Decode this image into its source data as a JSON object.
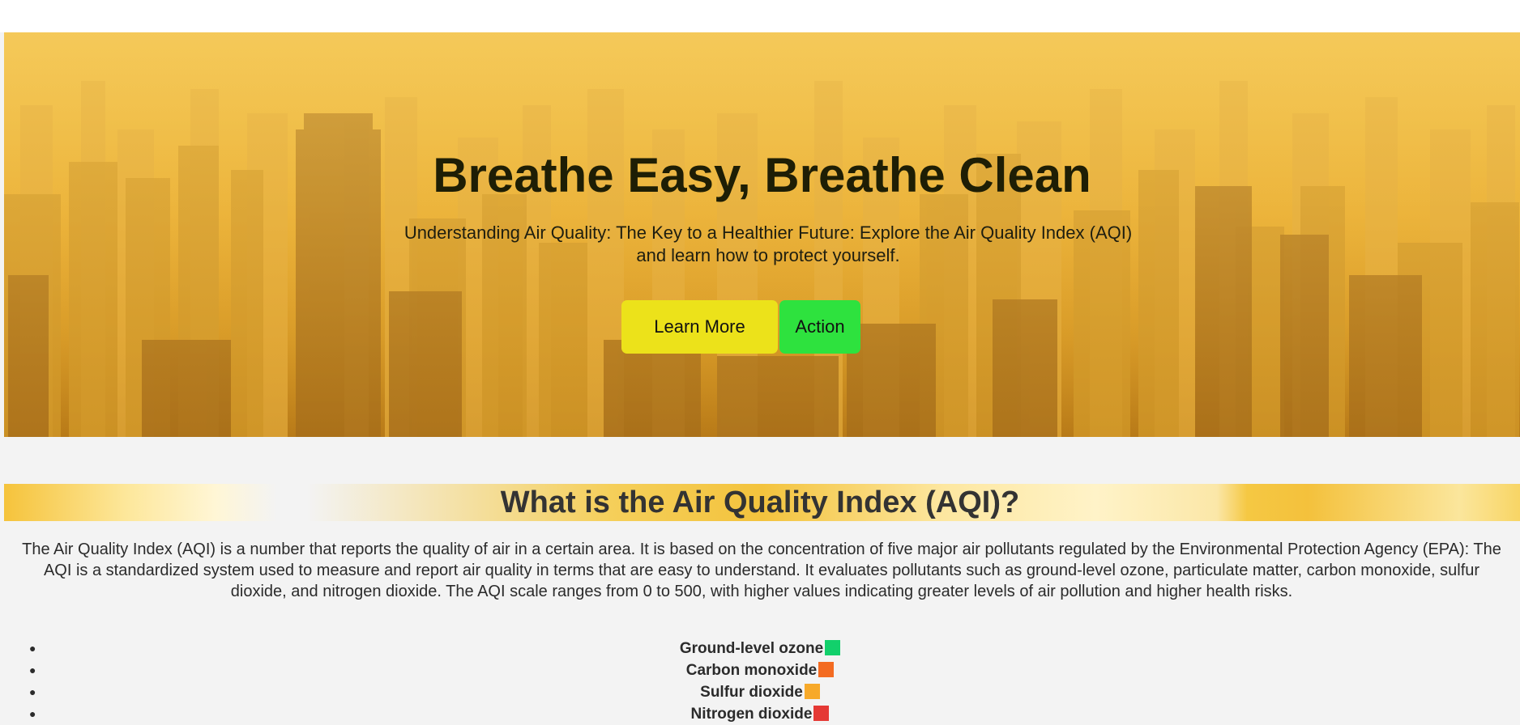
{
  "hero": {
    "title": "Breathe Easy, Breathe Clean",
    "subtitle": "Understanding Air Quality: The Key to a Healthier Future: Explore the Air Quality Index (AQI) and learn how to protect yourself.",
    "buttons": {
      "learn_more": "Learn More",
      "action": "Action"
    },
    "colors": {
      "learn_more": "#ece21a",
      "action": "#2ee23e"
    }
  },
  "aqi": {
    "heading": "What is the Air Quality Index (AQI)?",
    "description": "The Air Quality Index (AQI) is a number that reports the quality of air in a certain area. It is based on the concentration of five major air pollutants regulated by the Environmental Protection Agency (EPA): The AQI is a standardized system used to measure and report air quality in terms that are easy to understand. It evaluates pollutants such as ground-level ozone, particulate matter, carbon monoxide, sulfur dioxide, and nitrogen dioxide. The AQI scale ranges from 0 to 500, with higher values indicating greater levels of air pollution and higher health risks.",
    "pollutants": [
      {
        "name": "Ground-level ozone",
        "color": "#12d06b"
      },
      {
        "name": "Carbon monoxide",
        "color": "#f36b21"
      },
      {
        "name": "Sulfur dioxide",
        "color": "#f7a929"
      },
      {
        "name": "Nitrogen dioxide",
        "color": "#e53935"
      }
    ]
  }
}
